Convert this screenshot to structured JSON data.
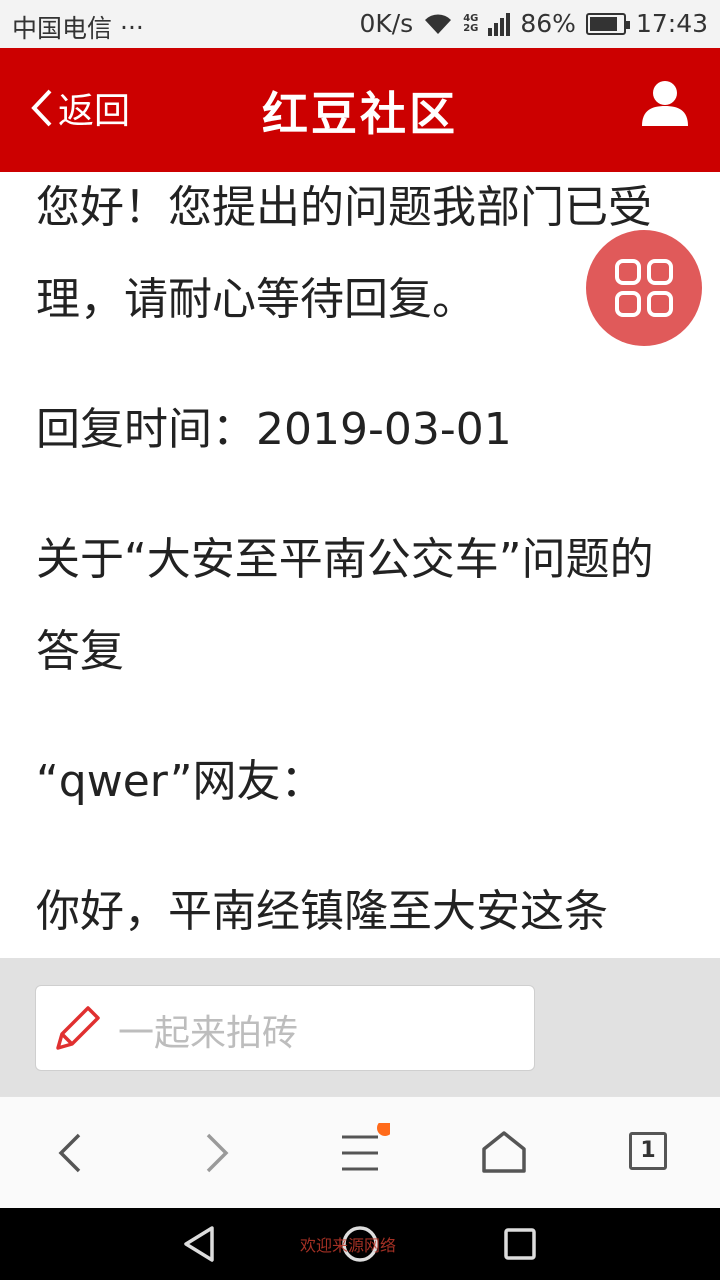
{
  "status_bar": {
    "carrier": "中国电信",
    "dots": "···",
    "speed": "0K/s",
    "net_top": "4G",
    "net_bottom": "2G",
    "battery": "86%",
    "battery_level": 0.86,
    "time": "17:43"
  },
  "header": {
    "back_label": "返回",
    "title": "红豆社区",
    "background": "#cc0000"
  },
  "content": {
    "paragraphs": [
      "您好！您提出的问题我部门已受理，请耐心等待回复。",
      "回复时间：2019-03-01",
      "关于“大安至平南公交车”问题的答复",
      "“qwer”网友：",
      "你好，平南经镇隆至大安这条"
    ]
  },
  "comment_bar": {
    "placeholder": "一起来拍砖"
  },
  "browser_toolbar": {
    "icons": [
      "back-icon",
      "forward-icon",
      "menu-icon",
      "home-icon",
      "tabs-icon"
    ],
    "tab_count": "1",
    "notification_dot_color": "#ff6a1a"
  },
  "android_nav": {
    "watermark": "欢迎来源网络"
  },
  "float_button": {
    "icon": "grid-icon",
    "color": "#e05a5a"
  }
}
